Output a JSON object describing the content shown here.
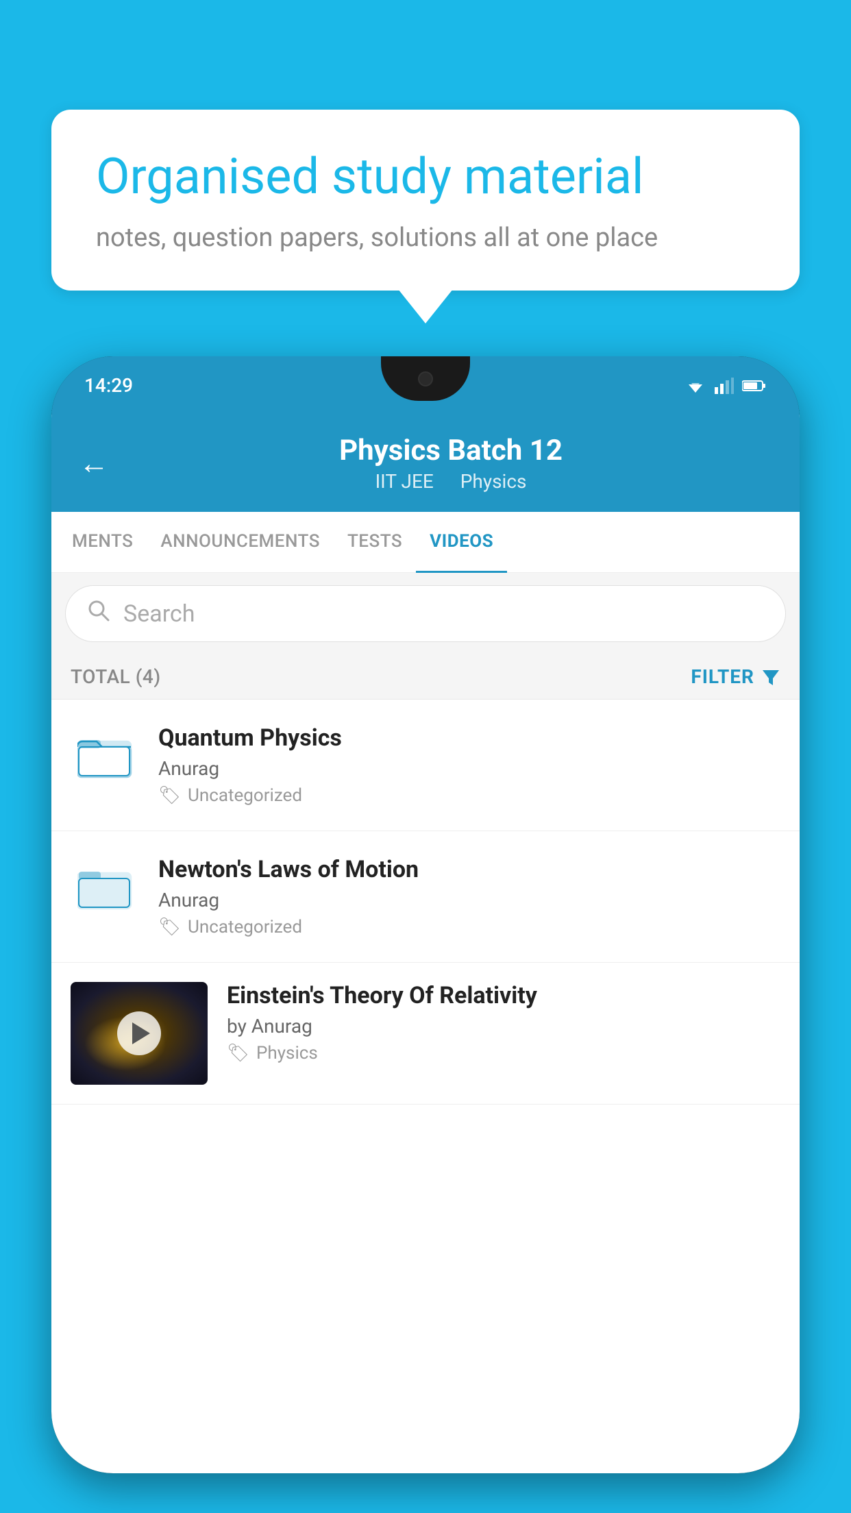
{
  "background": {
    "color": "#1bb8e8"
  },
  "bubble": {
    "title": "Organised study material",
    "subtitle": "notes, question papers, solutions all at one place"
  },
  "phone": {
    "status_bar": {
      "time": "14:29"
    },
    "header": {
      "title": "Physics Batch 12",
      "subtitle1": "IIT JEE",
      "subtitle2": "Physics",
      "back_label": "←"
    },
    "tabs": [
      {
        "label": "MENTS",
        "active": false
      },
      {
        "label": "ANNOUNCEMENTS",
        "active": false
      },
      {
        "label": "TESTS",
        "active": false
      },
      {
        "label": "VIDEOS",
        "active": true
      }
    ],
    "search": {
      "placeholder": "Search"
    },
    "filter_row": {
      "total_label": "TOTAL (4)",
      "filter_label": "FILTER"
    },
    "videos": [
      {
        "title": "Quantum Physics",
        "author": "Anurag",
        "tag": "Uncategorized",
        "type": "folder"
      },
      {
        "title": "Newton's Laws of Motion",
        "author": "Anurag",
        "tag": "Uncategorized",
        "type": "folder"
      },
      {
        "title": "Einstein's Theory Of Relativity",
        "author": "by Anurag",
        "tag": "Physics",
        "type": "video"
      }
    ]
  }
}
